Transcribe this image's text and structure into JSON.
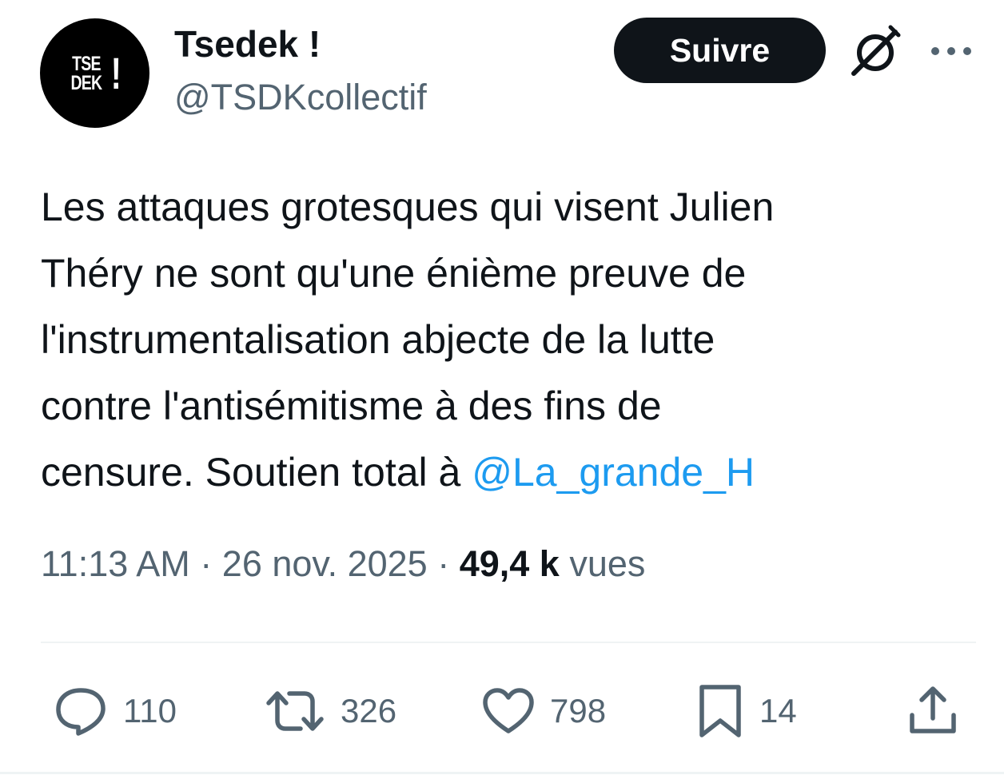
{
  "author": {
    "display_name": "Tsedek !",
    "handle": "@TSDKcollectif",
    "avatar_lines": [
      "TSE",
      "DEK"
    ],
    "avatar_mark": "!"
  },
  "header": {
    "follow_label": "Suivre",
    "grok_icon": "grok-icon",
    "more_icon": "more-icon"
  },
  "tweet": {
    "lines": [
      "Les attaques grotesques qui visent Julien",
      "Théry ne sont qu'une énième preuve de",
      "l'instrumentalisation abjecte de la lutte",
      "contre l'antisémitisme à des fins de"
    ],
    "last_line_prefix": "censure. Soutien total à ",
    "mention": "@La_grande_H"
  },
  "meta": {
    "time": "11:13 AM",
    "separator": " · ",
    "date": "26 nov. 2025",
    "views_count": "49,4 k",
    "views_label": "vues"
  },
  "actions": {
    "replies": "110",
    "retweets": "326",
    "likes": "798",
    "bookmarks": "14"
  },
  "colors": {
    "text": "#0f1419",
    "secondary": "#536471",
    "link": "#1d9bf0",
    "divider": "#eff3f4"
  }
}
